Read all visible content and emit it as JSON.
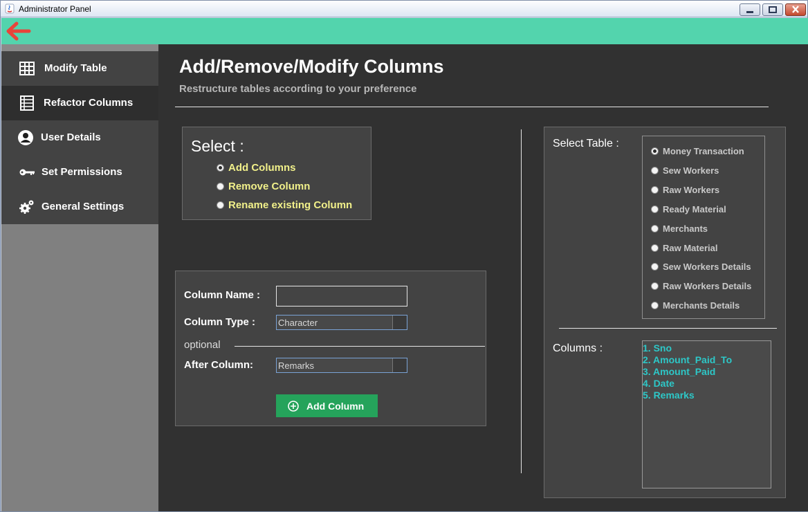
{
  "window": {
    "title": "Administrator Panel"
  },
  "sidebar": {
    "items": [
      {
        "label": "Modify Table",
        "icon": "table-icon"
      },
      {
        "label": "Refactor Columns",
        "icon": "columns-icon"
      },
      {
        "label": "User Details",
        "icon": "user-icon"
      },
      {
        "label": "Set Permissions",
        "icon": "key-icon"
      },
      {
        "label": "General Settings",
        "icon": "gear-icon"
      }
    ],
    "active_index": 1
  },
  "header": {
    "title": "Add/Remove/Modify Columns",
    "subtitle": "Restructure tables according to your preference"
  },
  "select_panel": {
    "title": "Select :",
    "options": [
      "Add Columns",
      "Remove Column",
      "Rename existing Column"
    ],
    "selected": "Add Columns"
  },
  "form": {
    "column_name_label": "Column Name :",
    "column_name_value": "",
    "column_type_label": "Column Type  :",
    "column_type_value": "Character",
    "optional_label": "optional",
    "after_column_label": "After Column:",
    "after_column_value": "Remarks",
    "add_button_label": "Add Column"
  },
  "tables": {
    "label": "Select Table :",
    "options": [
      "Money Transaction",
      "Sew Workers",
      "Raw Workers",
      "Ready Material",
      "Merchants",
      "Raw Material",
      "Sew Workers Details",
      "Raw Workers Details",
      "Merchants Details"
    ],
    "selected": "Money Transaction"
  },
  "columns": {
    "label": "Columns :",
    "items": [
      "1.  Sno",
      "2.  Amount_Paid_To",
      "3.  Amount_Paid",
      "4.  Date",
      "5.  Remarks"
    ]
  },
  "colors": {
    "topbar": "#53d4ad",
    "accent_green": "#25a35b",
    "option_yellow": "#f1f08a",
    "list_cyan": "#2dc8c8"
  }
}
